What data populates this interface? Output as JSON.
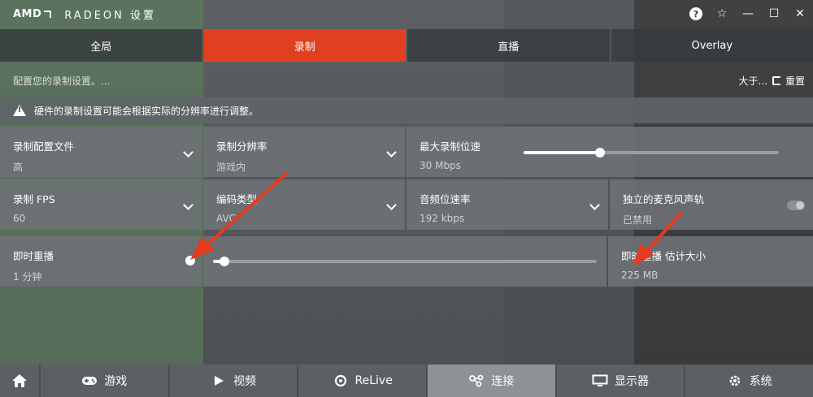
{
  "titlebar": {
    "brand": "AMD",
    "app_title": "RADEON 设置",
    "help_glyph": "?",
    "favorite_glyph": "☆",
    "minimize_glyph": "—",
    "maximize_glyph": "☐",
    "close_glyph": "✕"
  },
  "tabs": [
    {
      "label": "全局"
    },
    {
      "label": "录制"
    },
    {
      "label": "直播"
    },
    {
      "label": "Overlay"
    }
  ],
  "subheader": {
    "description": "配置您的录制设置。...",
    "about_label": "大于...",
    "reset_label": "重置"
  },
  "warning": {
    "text": "硬件的录制设置可能会根据实际的分辨率进行调整。"
  },
  "settings": {
    "profile": {
      "label": "录制配置文件",
      "value": "高"
    },
    "resolution": {
      "label": "录制分辨率",
      "value": "游戏内"
    },
    "bitrate": {
      "label": "最大录制位速",
      "value": "30 Mbps",
      "slider_fraction": 0.3
    },
    "fps": {
      "label": "录制 FPS",
      "value": "60"
    },
    "codec": {
      "label": "编码类型",
      "value": "AVC"
    },
    "audio_bitrate": {
      "label": "音频位速率",
      "value": "192 kbps"
    },
    "mic_track": {
      "label": "独立的麦克风声轨",
      "value": "已禁用",
      "enabled": false
    },
    "instant_replay": {
      "label": "即时重播",
      "value": "1 分钟",
      "enabled": true,
      "slider_fraction": 0.03
    },
    "replay_size": {
      "label": "即时重播 估计大小",
      "value": "225 MB"
    }
  },
  "bottom_nav": {
    "home_icon": "home-icon",
    "items": [
      {
        "label": "游戏",
        "icon": "gamepad-icon"
      },
      {
        "label": "视频",
        "icon": "play-icon"
      },
      {
        "label": "ReLive",
        "icon": "relive-icon"
      },
      {
        "label": "连接",
        "icon": "connect-icon"
      },
      {
        "label": "显示器",
        "icon": "monitor-icon"
      },
      {
        "label": "系统",
        "icon": "system-icon"
      }
    ],
    "active_index": 3
  },
  "colors": {
    "accent": "#e0401f",
    "annotation_arrow": "#e53a1e"
  }
}
